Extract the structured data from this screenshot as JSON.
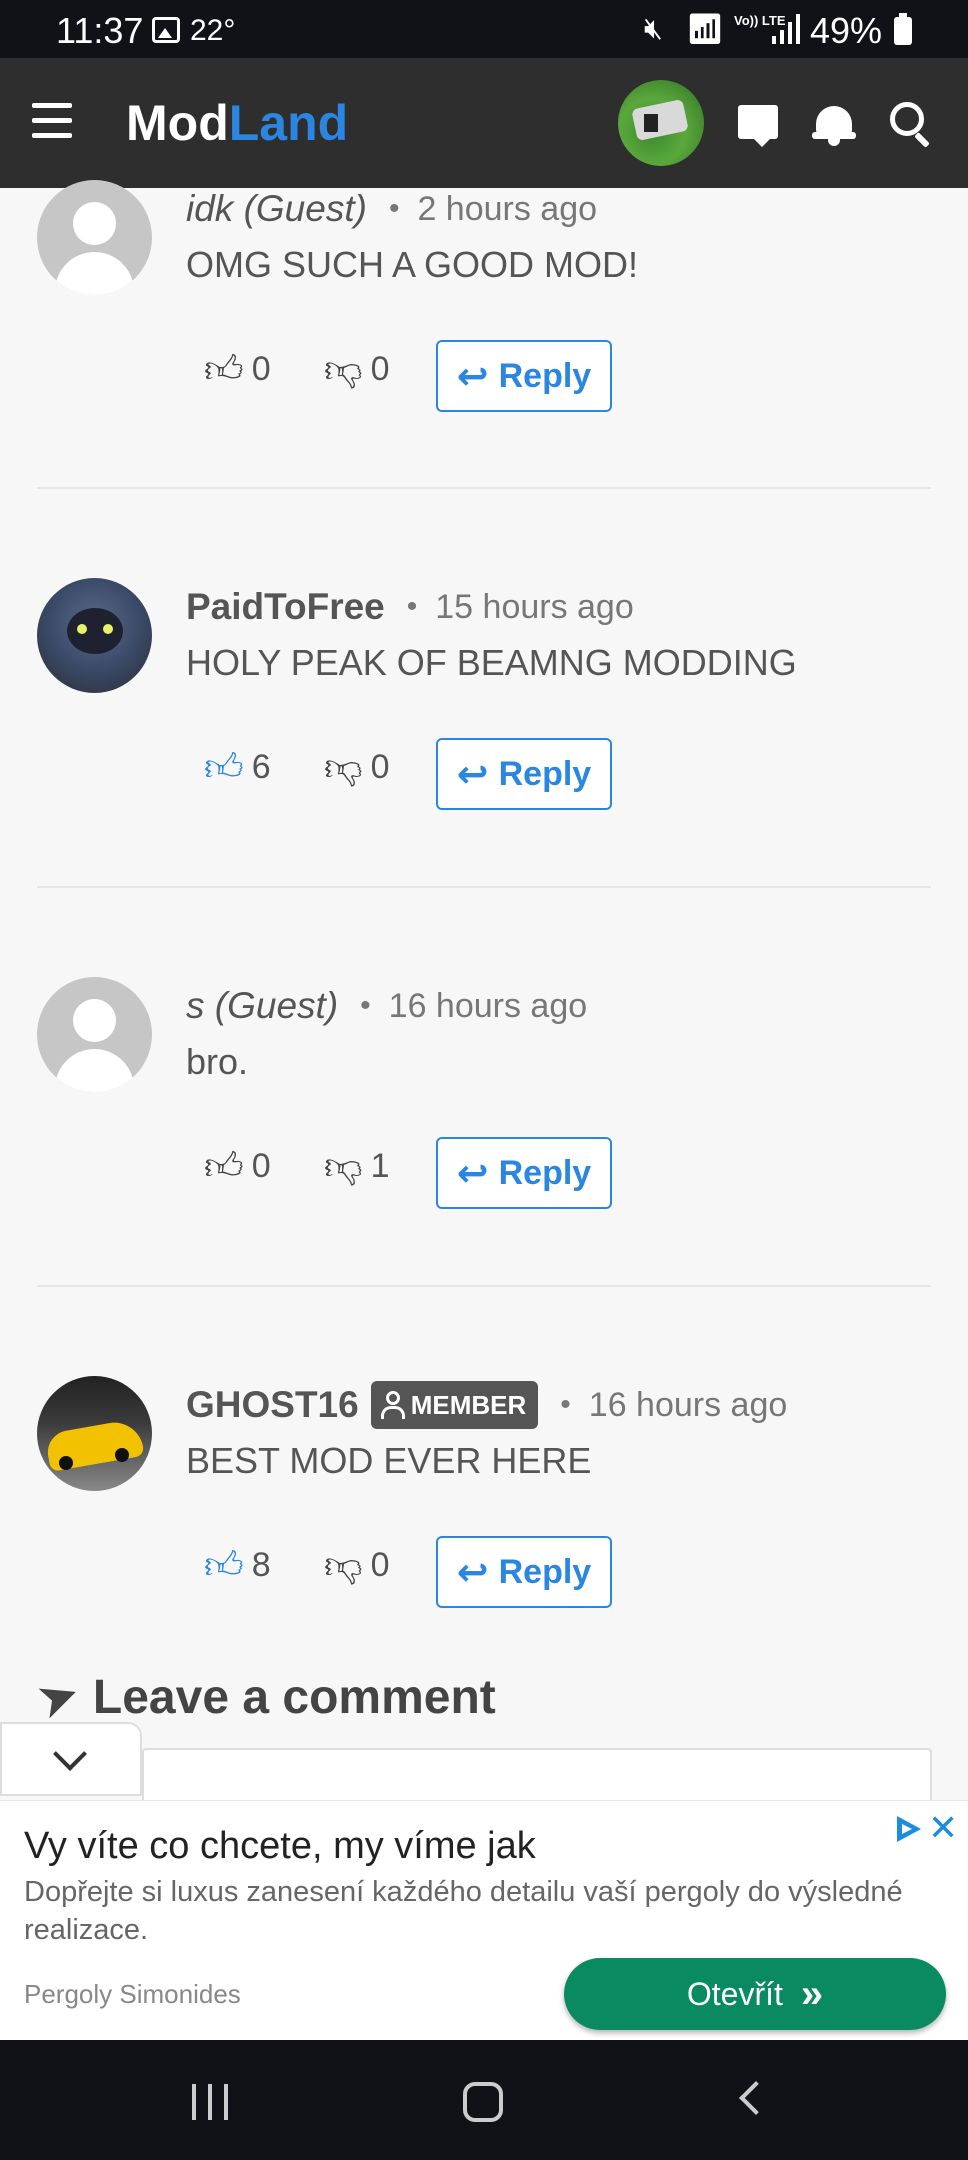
{
  "status_bar": {
    "time": "11:37",
    "temperature": "22°",
    "lte": "Vo)) LTE",
    "battery": "49%"
  },
  "header": {
    "logo_part1": "Mod",
    "logo_part2": "Land",
    "icons": [
      "menu-icon",
      "user-avatar",
      "messages-icon",
      "notifications-icon",
      "search-icon"
    ]
  },
  "comments": [
    {
      "author": "idk (Guest)",
      "time": "2 hours ago",
      "text": "OMG SUCH A GOOD MOD!",
      "likes": "0",
      "dislikes": "0",
      "reply_label": "Reply"
    },
    {
      "author": "PaidToFree",
      "time": "15 hours ago",
      "text": "HOLY PEAK OF BEAMNG MODDING",
      "likes": "6",
      "dislikes": "0",
      "reply_label": "Reply"
    },
    {
      "author": "s (Guest)",
      "time": "16 hours ago",
      "text": "bro.",
      "likes": "0",
      "dislikes": "1",
      "reply_label": "Reply"
    },
    {
      "author": "GHOST16",
      "badge": "MEMBER",
      "time": "16 hours ago",
      "text": "BEST MOD EVER HERE",
      "likes": "8",
      "dislikes": "0",
      "reply_label": "Reply"
    }
  ],
  "leave_comment": {
    "heading": "Leave a comment"
  },
  "ad": {
    "title": "Vy víte co chcete, my víme jak",
    "description": "Dopřejte si luxus zanesení každého detailu vaší pergoly do výsledné realizace.",
    "brand": "Pergoly Simonides",
    "cta": "Otevřít",
    "accent_color": "#0a8a60"
  },
  "colors": {
    "brand_blue": "#2a86e0",
    "header_bg": "#2e2e2e"
  }
}
